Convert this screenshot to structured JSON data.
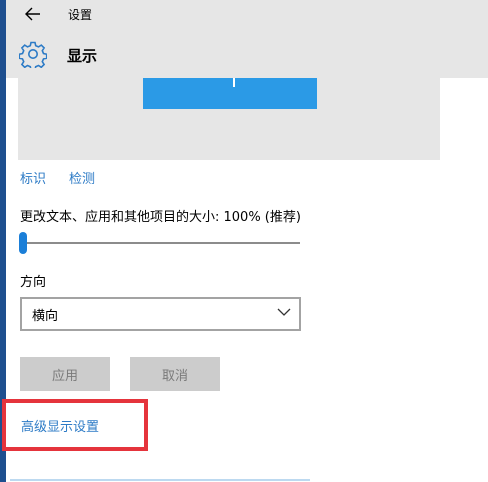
{
  "window": {
    "title": "设置",
    "back_icon": "arrow-left-icon"
  },
  "header": {
    "page_title": "显示",
    "icon": "gear-icon"
  },
  "preview": {
    "monitor_color": "#2b9ae6"
  },
  "links": {
    "identify": "标识",
    "detect": "检测"
  },
  "scale": {
    "label": "更改文本、应用和其他项目的大小: 100% (推荐)",
    "value_fraction": 0
  },
  "orientation": {
    "label": "方向",
    "selected": "横向"
  },
  "buttons": {
    "apply": "应用",
    "cancel": "取消"
  },
  "advanced": {
    "label": "高级显示设置"
  },
  "colors": {
    "accent": "#1b7fd8",
    "link": "#2d7bc6",
    "highlight": "#e5343c"
  }
}
